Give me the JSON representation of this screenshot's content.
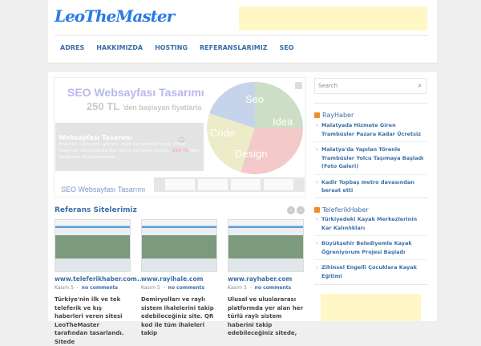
{
  "header": {
    "logo": "LeoTheMaster"
  },
  "nav": [
    "ADRES",
    "HAKKIMIZDA",
    "HOSTING",
    "REFERANSLARIMIZ",
    "SEO"
  ],
  "slider": {
    "headline": "SEO Websayfası Tasarımı",
    "price": "250 TL",
    "price_suffix": "'den başlayan fiyatlarla",
    "pie_labels": [
      "Seo",
      "Idea",
      "Code",
      "Design"
    ],
    "caption_title": "Websayfası Tasarımı",
    "caption_text": "Prestijli, işlevsel, görsel, hızlı ve güvenli web sitesi tasarımı konusunda her türlü yardıma açığız.",
    "caption_price": "250 TL",
    "caption_text2": "'den başlayan fiyatlarımızla...",
    "next_title": "SEO Websayfası Tasarımı"
  },
  "references": {
    "heading": "Referans Sitelerimiz",
    "cards": [
      {
        "url": "www.teleferikhaber.com...",
        "date": "Kasım 5",
        "comments": "no comments",
        "text": "Türkiye'nin ilk ve tek teleferik ve kış haberleri veren sitesi LeoTheMaster tarafından tasarlandı. Sitede"
      },
      {
        "url": "www.rayihale.com",
        "date": "Kasım 5",
        "comments": "no comments",
        "text": "Demiryolları ve raylı sistem ihalelerini takip edebileceğiniz site. QR kod ile tüm ihaleleri takip"
      },
      {
        "url": "www.rayhaber.com",
        "date": "Kasım 5",
        "comments": "no comments",
        "text": "Ulusal ve uluslararası platformda yer alan her türlü raylı sistem haberini takip edebileceğiniz sitede,"
      }
    ]
  },
  "sidebar": {
    "search_placeholder": "Search",
    "widgets": [
      {
        "title": "RayHaber",
        "items": [
          "Malatyada Hizmete Giren Trambüsler Pazara Kadar Ücretsiz",
          "Malatya'da Yapılan Törenle Trambüsler Yolcu Taşımaya Başladı (Foto Galeri)",
          "Kadir Topbaş metro davasından beraat etti"
        ]
      },
      {
        "title": "TeleferikHaber",
        "items": [
          "Türkiyedeki Kayak Merkezlerinin Kar Kalınlıkları",
          "Büyükşehir Belediyemle Kayak Öğreniyorum Projesi Başladı",
          "Zihinsel Engelli Çocuklara Kayak Eğitimi"
        ]
      }
    ]
  },
  "colors": {
    "link": "#3a6ea8",
    "ad": "#fff8c6",
    "rss": "#f28c28"
  }
}
